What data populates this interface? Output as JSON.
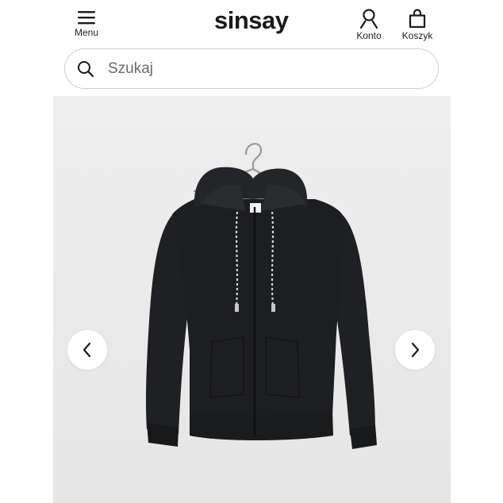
{
  "header": {
    "menu_label": "Menu",
    "logo_text": "sinsay",
    "account_label": "Konto",
    "cart_label": "Koszyk"
  },
  "search": {
    "placeholder": "Szukaj",
    "value": ""
  },
  "gallery": {
    "prev_icon": "chevron-left-icon",
    "next_icon": "chevron-right-icon",
    "product_image": "black zip hoodie on hanger",
    "background_color": "#ececec"
  },
  "colors": {
    "text": "#1a1a1a",
    "border": "#cfcfcf",
    "gallery_bg": "#ececec",
    "garment": "#1d1e21"
  }
}
